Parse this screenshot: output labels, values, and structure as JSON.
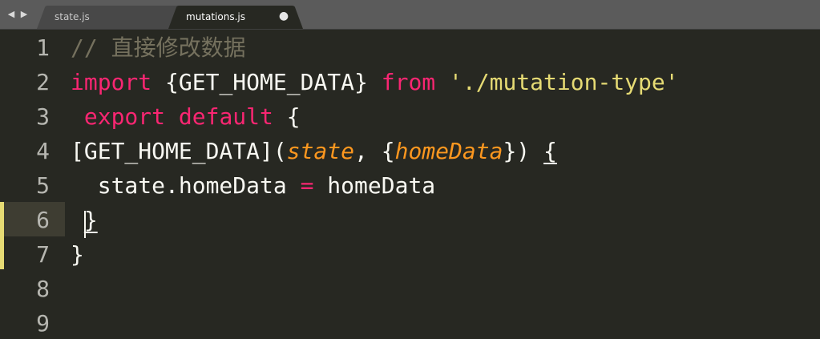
{
  "tabs": [
    {
      "label": "state.js",
      "close_glyph": "×",
      "active": false
    },
    {
      "label": "mutations.js",
      "close_glyph": "●",
      "active": true
    }
  ],
  "nav": {
    "back_glyph": "◀",
    "forward_glyph": "▶"
  },
  "colors": {
    "background": "#272822",
    "keyword": "#f92672",
    "string": "#e6db74",
    "parameter": "#fd971f",
    "comment": "#75715e",
    "text": "#f8f8f2",
    "line_number": "#b6b6b0",
    "modified_marker": "#e6db74"
  },
  "editor": {
    "line_numbers": [
      "1",
      "2",
      "3",
      "4",
      "5",
      "6",
      "7",
      "8",
      "9"
    ],
    "current_line": 6,
    "lines": [
      {
        "tokens": [
          {
            "text": "// 直接修改数据",
            "type": "comment"
          }
        ]
      },
      {
        "tokens": [
          {
            "text": "import",
            "type": "keyword"
          },
          {
            "text": " {GET_HOME_DATA} ",
            "type": "plain"
          },
          {
            "text": "from",
            "type": "keyword"
          },
          {
            "text": " ",
            "type": "plain"
          },
          {
            "text": "'./mutation-type'",
            "type": "string"
          }
        ]
      },
      {
        "tokens": [
          {
            "text": " ",
            "type": "plain"
          },
          {
            "text": "export",
            "type": "keyword"
          },
          {
            "text": " ",
            "type": "plain"
          },
          {
            "text": "default",
            "type": "keyword"
          },
          {
            "text": " {",
            "type": "plain"
          }
        ]
      },
      {
        "tokens": [
          {
            "text": "[GET_HOME_DATA](",
            "type": "plain"
          },
          {
            "text": "state",
            "type": "param"
          },
          {
            "text": ", {",
            "type": "plain"
          },
          {
            "text": "homeData",
            "type": "param"
          },
          {
            "text": "}) ",
            "type": "plain"
          },
          {
            "text": "{",
            "type": "brace"
          }
        ]
      },
      {
        "tokens": [
          {
            "text": "  state.homeData ",
            "type": "plain"
          },
          {
            "text": "=",
            "type": "keyword"
          },
          {
            "text": " homeData",
            "type": "plain"
          }
        ]
      },
      {
        "tokens": [
          {
            "text": " ",
            "type": "plain"
          },
          {
            "text": "}",
            "type": "brace"
          }
        ]
      },
      {
        "tokens": [
          {
            "text": "}",
            "type": "plain"
          }
        ]
      },
      {
        "tokens": []
      },
      {
        "tokens": []
      }
    ]
  }
}
